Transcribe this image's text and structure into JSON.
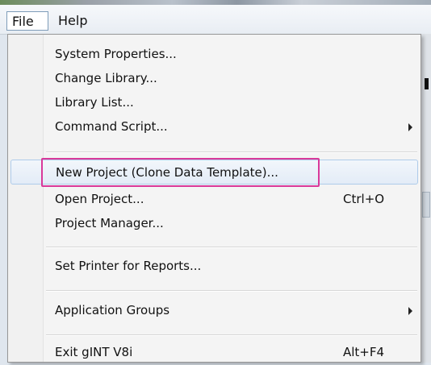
{
  "menubar": {
    "file_label": "File",
    "help_label": "Help"
  },
  "menu": {
    "items": [
      {
        "label": "System Properties..."
      },
      {
        "label": "Change Library..."
      },
      {
        "label": "Library List..."
      },
      {
        "label": "Command Script...",
        "submenu": true
      },
      {
        "label": "New Project (Clone Data Template)...",
        "highlighted": true
      },
      {
        "label": "Open Project...",
        "shortcut": "Ctrl+O"
      },
      {
        "label": "Project Manager..."
      },
      {
        "label": "Set Printer for Reports..."
      },
      {
        "label": "Application Groups",
        "submenu": true
      },
      {
        "label": "Exit gINT V8i",
        "shortcut": "Alt+F4"
      }
    ]
  },
  "colors": {
    "annotation_box": "#d9399a",
    "hover_border": "#aecbea"
  }
}
